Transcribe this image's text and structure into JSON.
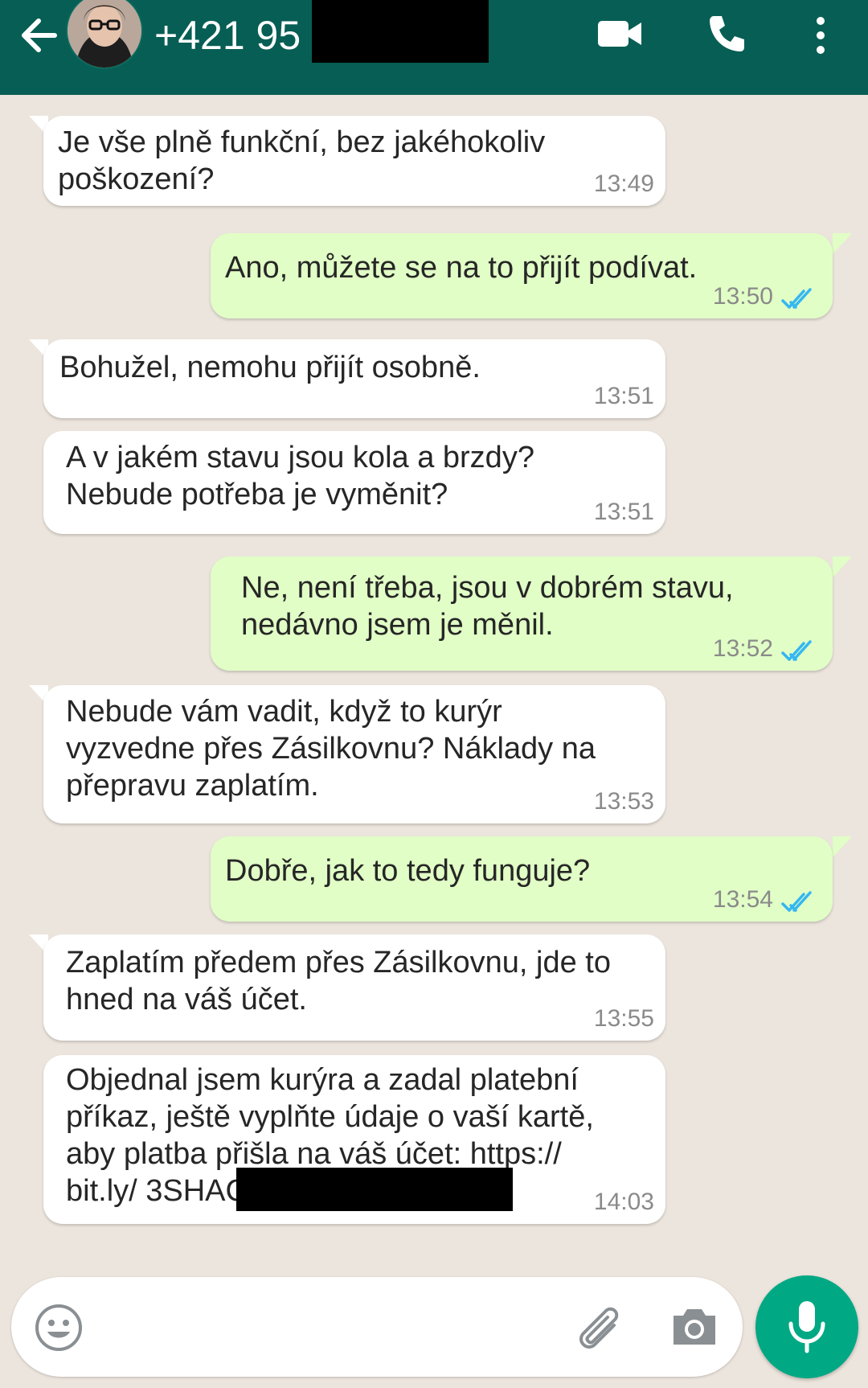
{
  "header": {
    "title": "+421 95",
    "accent_color": "#075e54",
    "icons": [
      "back-arrow-icon",
      "video-call-icon",
      "phone-call-icon",
      "more-options-icon"
    ]
  },
  "messages": [
    {
      "direction": "in",
      "text": "Je vše plně funkční, bez jakéhokoliv\npoškození?",
      "time": "13:49"
    },
    {
      "direction": "out",
      "text": "Ano, můžete se na to přijít podívat.",
      "time": "13:50",
      "read": true
    },
    {
      "direction": "in",
      "text": "Bohužel, nemohu přijít osobně.",
      "time": "13:51"
    },
    {
      "direction": "in",
      "text": "A v jakém stavu jsou kola a brzdy?\nNebude potřeba je vyměnit?",
      "time": "13:51"
    },
    {
      "direction": "out",
      "text": "Ne, není třeba, jsou v dobrém stavu,\nnedávno jsem je měnil.",
      "time": "13:52",
      "read": true
    },
    {
      "direction": "in",
      "text": "Nebude vám vadit, když to kurýr\nvyzvedne přes Zásilkovnu? Náklady na\npřepravu zaplatím.",
      "time": "13:53"
    },
    {
      "direction": "out",
      "text": "Dobře, jak to tedy funguje?",
      "time": "13:54",
      "read": true
    },
    {
      "direction": "in",
      "text": "Zaplatím předem přes Zásilkovnu, jde to\nhned na váš účet.",
      "time": "13:55"
    },
    {
      "direction": "in",
      "text": "Objednal jsem kurýra a zadal platební\npříkaz, ještě vyplňte údaje o vaší kartě,\naby platba přišla na váš účet: https://\nbit.ly/ 3SHAC",
      "time": "14:03"
    }
  ],
  "input": {
    "placeholder": "",
    "icons": [
      "emoji-icon",
      "attach-icon",
      "camera-icon",
      "mic-icon"
    ],
    "send_button_color": "#00a884"
  },
  "colors": {
    "chat_background": "#ece5dd",
    "incoming_bubble": "#ffffff",
    "outgoing_bubble": "#e1fec6",
    "read_ticks": "#34b7f1"
  }
}
